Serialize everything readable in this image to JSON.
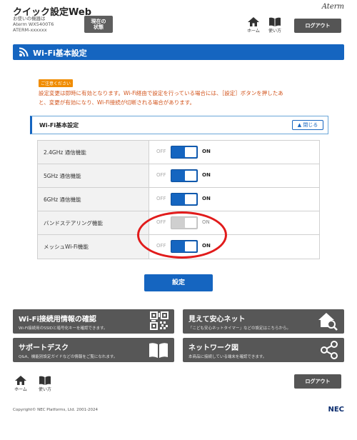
{
  "header": {
    "app_title": "クイック設定Web",
    "device_line1": "お使いの機器は",
    "device_line2": "Aterm WX5400T6",
    "device_line3": "ATERM-xxxxxx",
    "status_label_1": "現在の",
    "status_label_2": "状態",
    "brand": "Aterm",
    "home_label": "ホーム",
    "manual_label": "使い方",
    "logout_label": "ログアウト"
  },
  "banner": {
    "title": "Wi-Fi基本設定"
  },
  "notice": {
    "badge": "ご注意ください",
    "text_line1": "設定変更は即時に有効となります。Wi-Fi経由で設定を行っている場合には、［設定］ボタンを押したあ",
    "text_line2": "と、変更が有効になり、Wi-Fi接続が切断される場合があります。"
  },
  "section": {
    "title": "Wi-Fi基本設定",
    "close_label": "閉じる"
  },
  "settings": [
    {
      "label": "2.4GHz 通信機能",
      "off": "OFF",
      "on": "ON",
      "value": "ON"
    },
    {
      "label": "5GHz 通信機能",
      "off": "OFF",
      "on": "ON",
      "value": "ON"
    },
    {
      "label": "6GHz 通信機能",
      "off": "OFF",
      "on": "ON",
      "value": "ON"
    },
    {
      "label": "バンドステアリング機能",
      "off": "OFF",
      "on": "ON",
      "value": "ON (disabled)"
    },
    {
      "label": "メッシュWi-Fi機能",
      "off": "OFF",
      "on": "ON",
      "value": "ON"
    }
  ],
  "save_label": "設定",
  "tiles": [
    {
      "title": "Wi-Fi接続用情報の確認",
      "sub": "Wi-Fi接続用のSSIDと暗号化キーを確認できます。",
      "icon": "qr-code-icon"
    },
    {
      "title": "見えて安心ネット",
      "sub": "「こども安心ネットタイマー」などの設定はこちらから。",
      "icon": "house-search-icon"
    },
    {
      "title": "サポートデスク",
      "sub": "Q&A、機能別設定ガイドなどの情報をご覧になれます。",
      "icon": "book-icon"
    },
    {
      "title": "ネットワーク図",
      "sub": "本商品に接続している端末を確認できます。",
      "icon": "network-icon"
    }
  ],
  "footer": {
    "home_label": "ホーム",
    "manual_label": "使い方",
    "logout_label": "ログアウト",
    "copyright": "Copyright© NEC Platforms, Ltd. 2001-2024",
    "nec": "NEC"
  },
  "colors": {
    "accent": "#1565c0",
    "warning": "#f08c00",
    "notice_text": "#d2531b",
    "tile_bg": "#575757",
    "annotation": "#e11b1b"
  }
}
